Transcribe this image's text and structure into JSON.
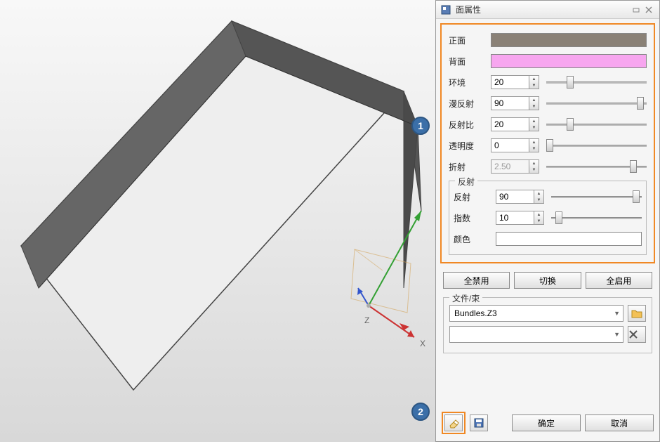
{
  "panel": {
    "title": "面属性",
    "props": {
      "front_face": "正面",
      "back_face": "背面",
      "ambient": "环境",
      "diffuse": "漫反射",
      "reflectance": "反射比",
      "transparency": "透明度",
      "refraction": "折射",
      "reflection_group": "反射",
      "reflection": "反射",
      "index": "指数",
      "color": "颜色"
    },
    "values": {
      "ambient": "20",
      "diffuse": "90",
      "reflectance": "20",
      "transparency": "0",
      "refraction": "2.50",
      "reflection": "90",
      "index": "10"
    },
    "colors": {
      "front": "#8a8176",
      "back": "#f7a6ef",
      "reflection_color": "#ffffff"
    },
    "slider_positions": {
      "ambient": 20,
      "diffuse": 90,
      "reflectance": 20,
      "transparency": 0,
      "refraction": 83,
      "reflection": 90,
      "index": 5
    },
    "buttons": {
      "disable_all": "全禁用",
      "toggle": "切换",
      "enable_all": "全启用",
      "ok": "确定",
      "cancel": "取消"
    },
    "file_section": {
      "legend": "文件/束",
      "bundle_value": "Bundles.Z3",
      "second_value": ""
    }
  },
  "callouts": {
    "one": "1",
    "two": "2"
  },
  "axes": {
    "x": "X",
    "z": "Z"
  }
}
